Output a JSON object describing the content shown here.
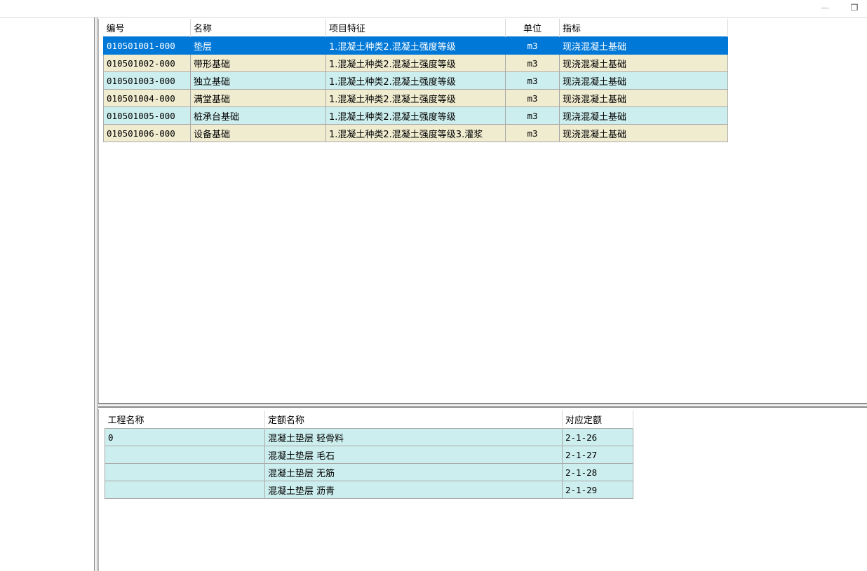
{
  "window": {
    "minimize_glyph": "—",
    "restore_glyph": "❐"
  },
  "items_table": {
    "headers": [
      "编号",
      "名称",
      "项目特征",
      "单位",
      "指标"
    ],
    "rows": [
      {
        "code": "010501001-000",
        "name": "垫层",
        "feature": "1.混凝土种类2.混凝土强度等级",
        "unit": "m3",
        "indicator": "现浇混凝土基础",
        "selected": true
      },
      {
        "code": "010501002-000",
        "name": "带形基础",
        "feature": "1.混凝土种类2.混凝土强度等级",
        "unit": "m3",
        "indicator": "现浇混凝土基础"
      },
      {
        "code": "010501003-000",
        "name": "独立基础",
        "feature": "1.混凝土种类2.混凝土强度等级",
        "unit": "m3",
        "indicator": "现浇混凝土基础"
      },
      {
        "code": "010501004-000",
        "name": "满堂基础",
        "feature": "1.混凝土种类2.混凝土强度等级",
        "unit": "m3",
        "indicator": "现浇混凝土基础"
      },
      {
        "code": "010501005-000",
        "name": "桩承台基础",
        "feature": "1.混凝土种类2.混凝土强度等级",
        "unit": "m3",
        "indicator": "现浇混凝土基础"
      },
      {
        "code": "010501006-000",
        "name": "设备基础",
        "feature": "1.混凝土种类2.混凝土强度等级3.灌浆",
        "unit": "m3",
        "indicator": "现浇混凝土基础"
      }
    ]
  },
  "quota_table": {
    "headers": [
      "工程名称",
      "定额名称",
      "对应定额"
    ],
    "rows": [
      {
        "project": "0",
        "quota_name": "混凝土垫层 轻骨料",
        "quota_code": "2-1-26"
      },
      {
        "project": "",
        "quota_name": "混凝土垫层 毛石",
        "quota_code": "2-1-27"
      },
      {
        "project": "",
        "quota_name": "混凝土垫层 无筋",
        "quota_code": "2-1-28"
      },
      {
        "project": "",
        "quota_name": "混凝土垫层 沥青",
        "quota_code": "2-1-29"
      }
    ]
  },
  "colors": {
    "selected_row": "#0078d7",
    "row_cyan": "#cdeeee",
    "row_beige": "#f0ecd0"
  }
}
